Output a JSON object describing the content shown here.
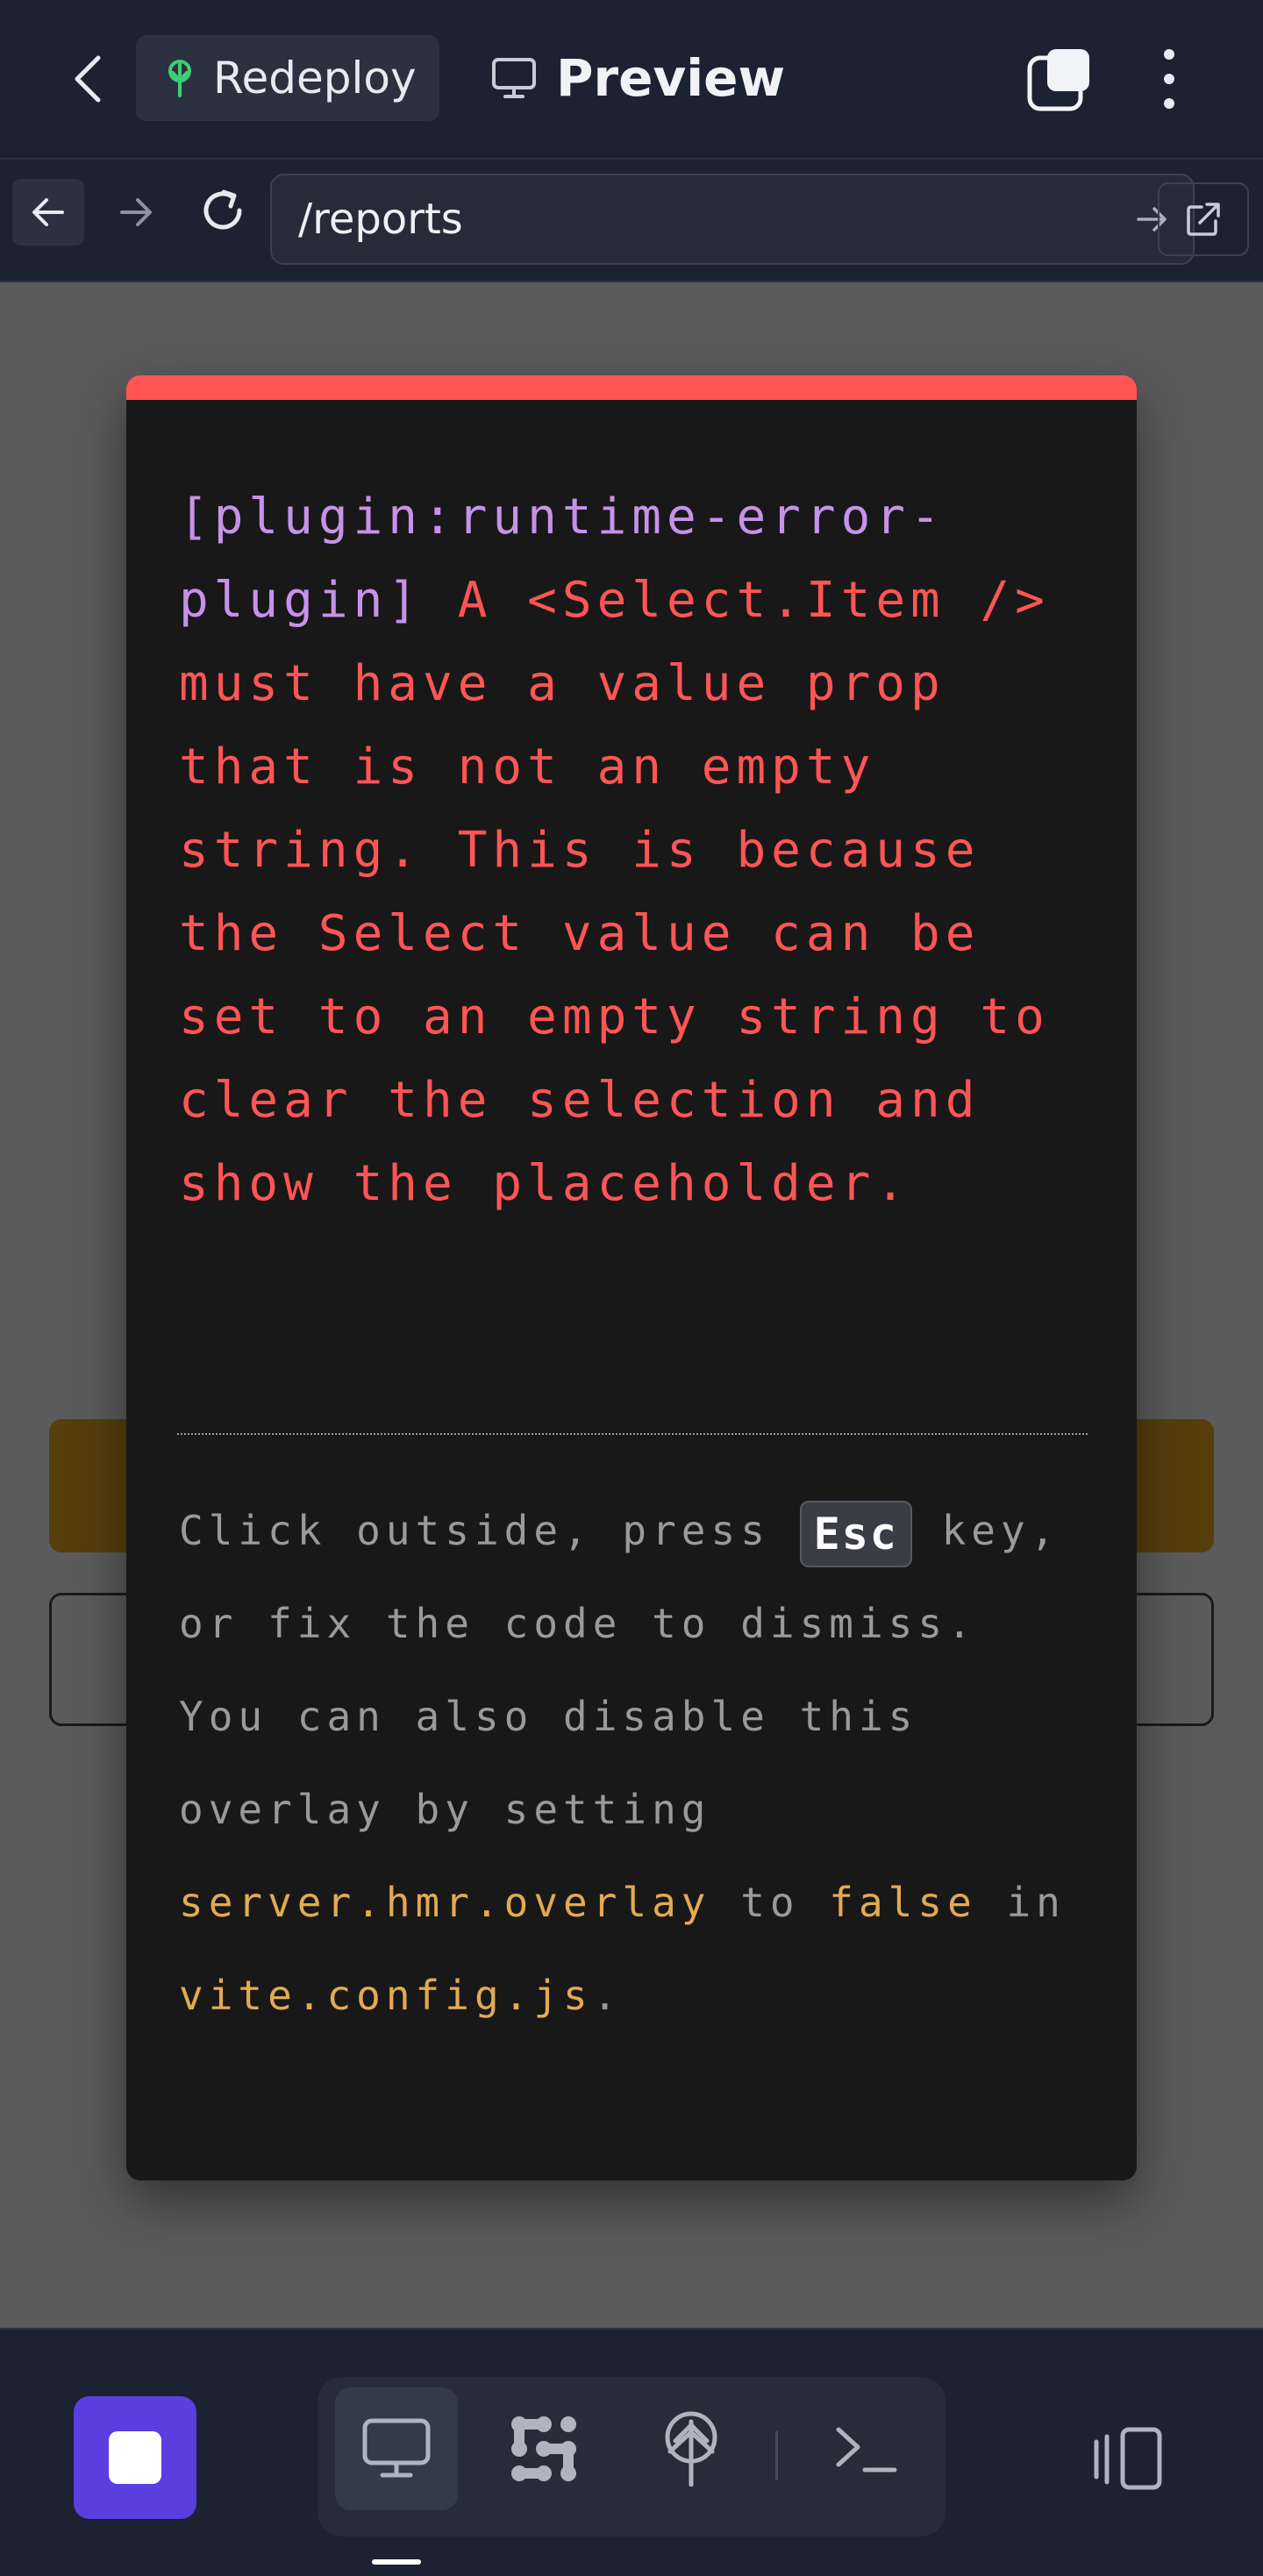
{
  "topbar": {
    "redeploy_label": "Redeploy",
    "preview_label": "Preview"
  },
  "urlbar": {
    "url": "/reports"
  },
  "error_overlay": {
    "plugin_prefix": "[plugin:runtime-error-plugin]",
    "message": "A <Select.Item /> must have a value prop that is not an empty string. This is because the Select value can be set to an empty string to clear the selection and show the placeholder.",
    "tip_before_key": "Click outside, press",
    "key_label": "Esc",
    "tip_after_key": "key, or fix the code to dismiss.",
    "tip_line2": "You can also disable this overlay by setting",
    "config_option": "server.hmr.overlay",
    "word_to": "to",
    "value_false": "false",
    "word_in": "in",
    "config_file": "vite.config.js",
    "period": "."
  },
  "colors": {
    "error_red": "#ff5555",
    "plugin_purple": "#c792ea",
    "code_yellow": "#e2aa53",
    "stop_button": "#5a3ee0"
  },
  "icons": {
    "back": "chevron-left-icon",
    "redeploy": "rocket-tree-icon",
    "preview": "monitor-icon",
    "tabs": "tabs-icon",
    "more": "more-vertical-icon",
    "nav_back": "arrow-left-icon",
    "nav_forward": "arrow-right-icon",
    "reload": "reload-icon",
    "go": "arrow-right-icon",
    "external": "external-link-icon",
    "stop": "stop-icon",
    "preview_tool": "monitor-icon",
    "agents_tool": "dots-grid-icon",
    "deploy_tool": "deploy-icon",
    "terminal_tool": "terminal-icon",
    "panel": "panel-icon"
  }
}
